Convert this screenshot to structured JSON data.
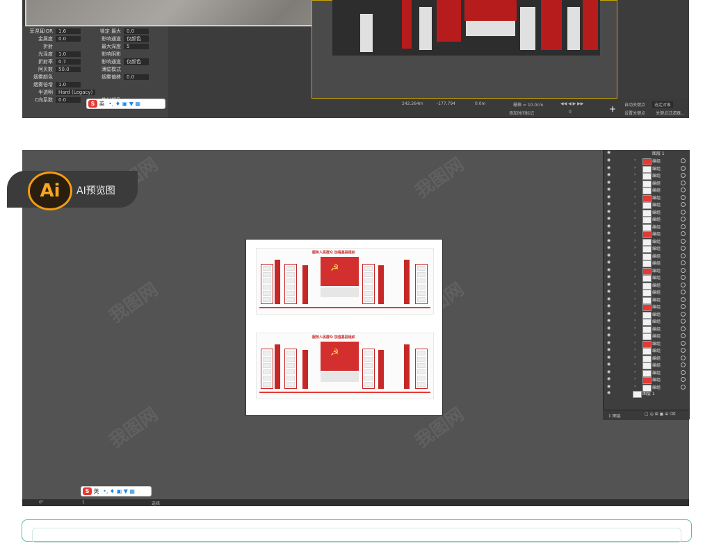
{
  "app": {
    "name": "AI预览图",
    "logo_text": "Ai"
  },
  "colors": {
    "accent": "#f39c12",
    "party_red": "#c62828",
    "canvas": "#535353",
    "panel": "#3e3e3e"
  },
  "material_panel": {
    "rows": [
      {
        "label": "菲涅耳IOR",
        "value": "1.6",
        "label2": "锁定 最大",
        "value2": "0.0"
      },
      {
        "label": "金属度",
        "value": "0.0",
        "label2": "影响通道",
        "value2": "仅颜色"
      },
      {
        "label": "折射",
        "value": "",
        "label2": "最大深度",
        "value2": "5"
      },
      {
        "label": "光泽度",
        "value": "1.0",
        "label2": "影响阴影",
        "value2": ""
      },
      {
        "label": "折射率",
        "value": "0.7",
        "label2": "影响通道",
        "value2": "仅颜色"
      },
      {
        "label": "阿贝数",
        "value": "50.0",
        "label2": "薄壁模式",
        "value2": ""
      },
      {
        "label": "烟雾颜色",
        "value": "",
        "label2": "烟雾偏移",
        "value2": "0.0"
      },
      {
        "label": "烟雾倍增",
        "value": "1.0",
        "label2": "",
        "value2": ""
      },
      {
        "label": "半透明",
        "value": "Hard (Legacy)",
        "label2": "",
        "value2": ""
      },
      {
        "label": "C向系数",
        "value": "0.0",
        "label2": "散射颜色",
        "value2": ""
      }
    ]
  },
  "timebar": {
    "x": "242.264m",
    "y": "-177.794",
    "z": "0.0m",
    "grid": "栅格 = 10.0cm",
    "autokey": "自动关键点",
    "selection": "选定对象",
    "setkey": "设置关键点",
    "keyfilter": "关键点过滤器...",
    "addtime": "添加时间标记",
    "frame": "0"
  },
  "ime": {
    "label": "英"
  },
  "artboard": {
    "design_title": "服务人民群众  加强基层组织",
    "panels": [
      "新时代 新征程",
      "不忘初心跟党走",
      "新目标 新征程",
      "中华民族再前进"
    ]
  },
  "layers": {
    "items": [
      "编组",
      "编组",
      "编组",
      "编组",
      "编组",
      "编组",
      "编组",
      "编组",
      "编组",
      "编组",
      "编组",
      "编组",
      "编组",
      "编组",
      "编组",
      "编组",
      "编组",
      "编组",
      "编组",
      "编组",
      "编组",
      "编组",
      "编组",
      "编组",
      "编组",
      "编组",
      "编组",
      "编组",
      "编组",
      "编组",
      "编组",
      "编组"
    ],
    "top_layer": "图层 1",
    "bottom_layer": "图层 1",
    "footer": "1 图层"
  },
  "statusbar": {
    "zoom": "0°",
    "page": "1",
    "tool": "选择"
  }
}
